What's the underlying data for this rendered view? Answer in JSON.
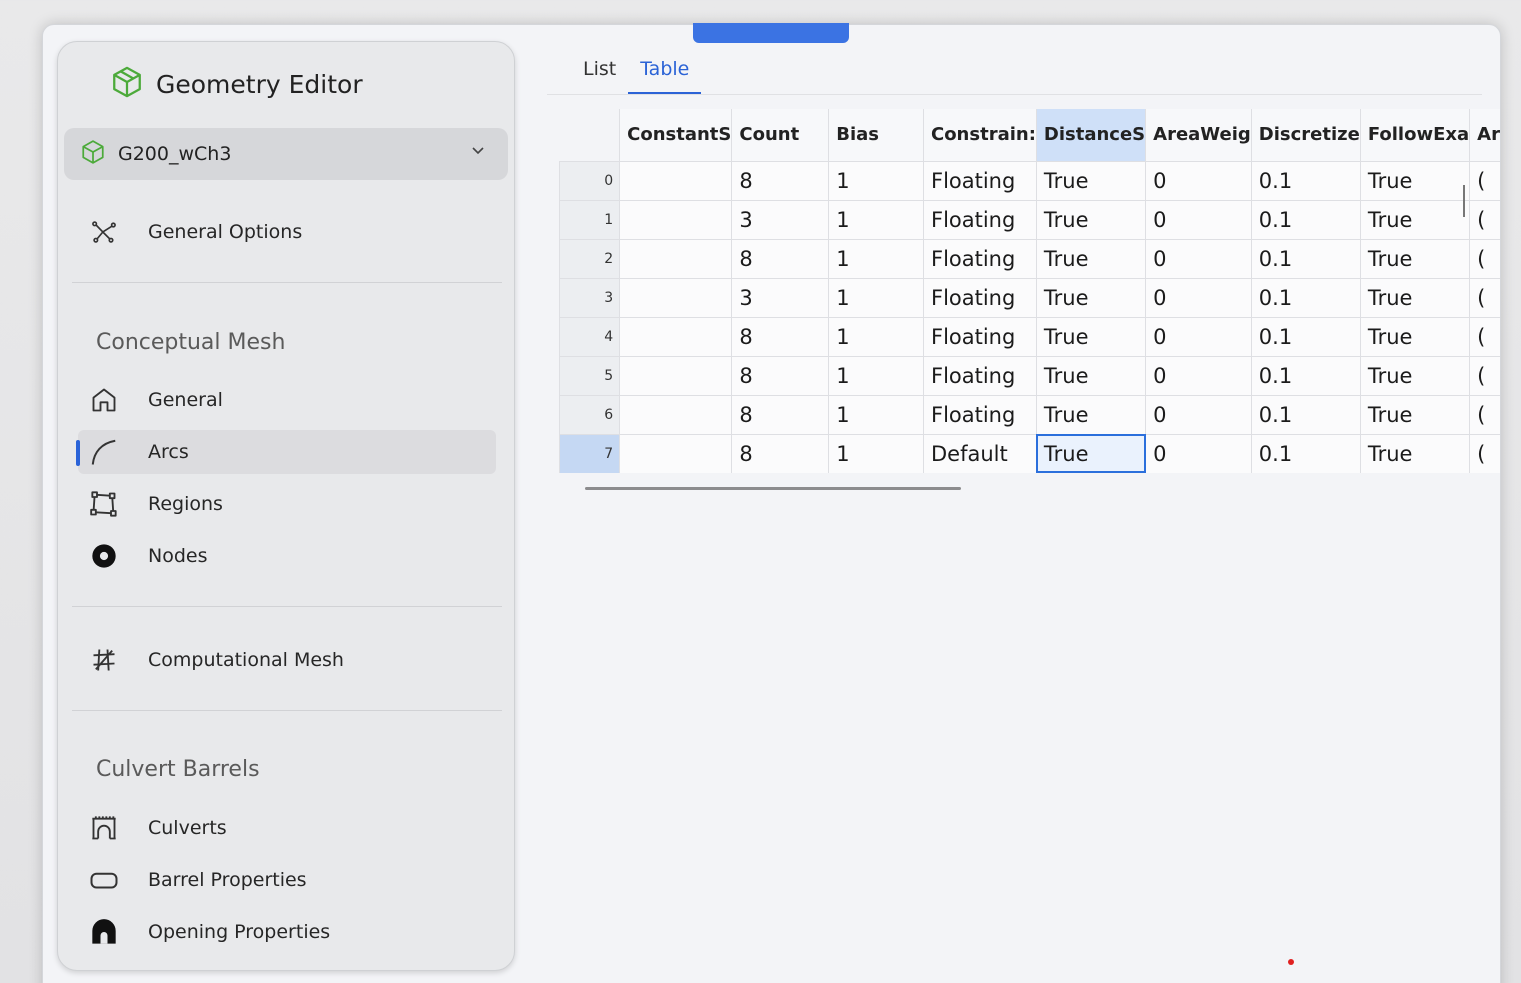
{
  "app": {
    "title": "Geometry Editor",
    "accent": "#2b63d6",
    "logo_color": "#4caa3a"
  },
  "selector": {
    "value": "G200_wCh3"
  },
  "sidebar": {
    "general_options": "General Options",
    "sections": [
      {
        "heading": "Conceptual Mesh"
      },
      {
        "heading": "Culvert Barrels"
      }
    ],
    "items": [
      {
        "label": "General",
        "icon": "home-icon"
      },
      {
        "label": "Arcs",
        "icon": "arc-icon",
        "active": true
      },
      {
        "label": "Regions",
        "icon": "region-icon"
      },
      {
        "label": "Nodes",
        "icon": "node-icon"
      },
      {
        "label": "Computational Mesh",
        "icon": "mesh-icon"
      },
      {
        "label": "Culverts",
        "icon": "culvert-icon"
      },
      {
        "label": "Barrel Properties",
        "icon": "barrel-icon"
      },
      {
        "label": "Opening Properties",
        "icon": "opening-icon"
      }
    ]
  },
  "tabs": [
    {
      "label": "List",
      "active": false
    },
    {
      "label": "Table",
      "active": true
    }
  ],
  "table": {
    "columns": [
      "ConstantS",
      "Count",
      "Bias",
      "Constrain:",
      "DistanceS",
      "AreaWeig",
      "Discretize",
      "FollowExa",
      "Ar"
    ],
    "rows": [
      {
        "index": "0",
        "cells": [
          "",
          "8",
          "1",
          "Floating",
          "True",
          "0",
          "0.1",
          "True",
          "("
        ]
      },
      {
        "index": "1",
        "cells": [
          "",
          "3",
          "1",
          "Floating",
          "True",
          "0",
          "0.1",
          "True",
          "("
        ]
      },
      {
        "index": "2",
        "cells": [
          "",
          "8",
          "1",
          "Floating",
          "True",
          "0",
          "0.1",
          "True",
          "("
        ]
      },
      {
        "index": "3",
        "cells": [
          "",
          "3",
          "1",
          "Floating",
          "True",
          "0",
          "0.1",
          "True",
          "("
        ]
      },
      {
        "index": "4",
        "cells": [
          "",
          "8",
          "1",
          "Floating",
          "True",
          "0",
          "0.1",
          "True",
          "("
        ]
      },
      {
        "index": "5",
        "cells": [
          "",
          "8",
          "1",
          "Floating",
          "True",
          "0",
          "0.1",
          "True",
          "("
        ]
      },
      {
        "index": "6",
        "cells": [
          "",
          "8",
          "1",
          "Floating",
          "True",
          "0",
          "0.1",
          "True",
          "("
        ]
      },
      {
        "index": "7",
        "cells": [
          "",
          "8",
          "1",
          "Default",
          "True",
          "0",
          "0.1",
          "True",
          "("
        ]
      }
    ],
    "selected_row": 7,
    "selected_column": 4
  }
}
